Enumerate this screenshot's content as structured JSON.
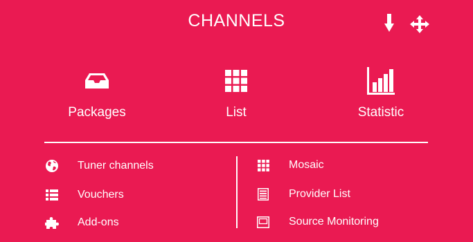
{
  "header": {
    "title": "CHANNELS",
    "icons": [
      "arrow-down-icon",
      "move-arrows-icon"
    ]
  },
  "main_options": [
    {
      "label": "Packages",
      "icon": "tray-icon"
    },
    {
      "label": "List",
      "icon": "grid-icon"
    },
    {
      "label": "Statistic",
      "icon": "bar-chart-icon"
    }
  ],
  "left_list": [
    {
      "label": "Tuner channels",
      "icon": "globe-icon"
    },
    {
      "label": "Vouchers",
      "icon": "list-icon"
    },
    {
      "label": "Add-ons",
      "icon": "puzzle-icon"
    }
  ],
  "right_list": [
    {
      "label": "Mosaic",
      "icon": "grid-icon"
    },
    {
      "label": "Provider List",
      "icon": "document-list-icon"
    },
    {
      "label": "Source Monitoring",
      "icon": "monitor-icon"
    }
  ],
  "colors": {
    "background": "#EA1A52",
    "foreground": "#FFFFFF"
  }
}
